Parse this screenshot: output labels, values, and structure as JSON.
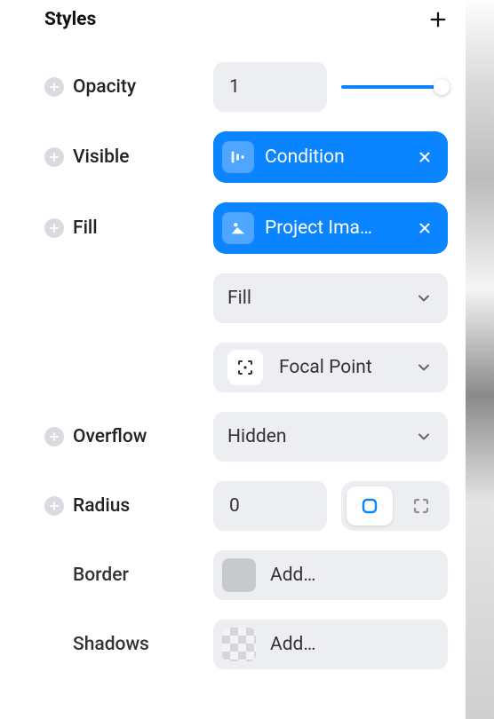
{
  "section": {
    "title": "Styles"
  },
  "opacity": {
    "label": "Opacity",
    "value": "1",
    "slider": 1.0
  },
  "visible": {
    "label": "Visible",
    "chip_label": "Condition"
  },
  "fill": {
    "label": "Fill",
    "chip_label": "Project Ima…",
    "fit_select": "Fill",
    "focal_label": "Focal Point"
  },
  "overflow": {
    "label": "Overflow",
    "value": "Hidden"
  },
  "radius": {
    "label": "Radius",
    "value": "0"
  },
  "border": {
    "label": "Border",
    "placeholder": "Add…"
  },
  "shadows": {
    "label": "Shadows",
    "placeholder": "Add…"
  },
  "colors": {
    "accent": "#0a84ff"
  }
}
